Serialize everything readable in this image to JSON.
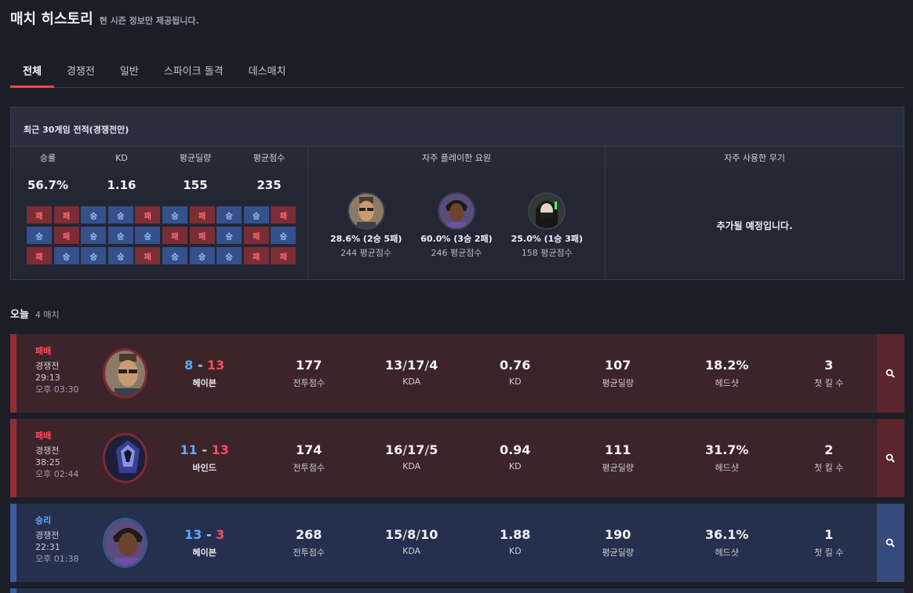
{
  "header": {
    "title": "매치 히스토리",
    "subtitle": "현 시즌 정보만 제공됩니다."
  },
  "tabs": [
    "전체",
    "경쟁전",
    "일반",
    "스파이크 돌격",
    "데스매치"
  ],
  "summary": {
    "title": "최근 30게임 전적(경쟁전만)",
    "stats": [
      {
        "label": "승률",
        "value": "56.7%"
      },
      {
        "label": "KD",
        "value": "1.16"
      },
      {
        "label": "평균딜량",
        "value": "155"
      },
      {
        "label": "평균점수",
        "value": "235"
      }
    ],
    "results": [
      "패",
      "패",
      "승",
      "승",
      "패",
      "승",
      "패",
      "승",
      "승",
      "패",
      "승",
      "패",
      "승",
      "승",
      "승",
      "패",
      "패",
      "승",
      "패",
      "승",
      "패",
      "승",
      "승",
      "승",
      "패",
      "승",
      "승",
      "승",
      "패",
      "패"
    ],
    "agents_title": "자주 플레이한 요원",
    "agents": [
      {
        "line1": "28.6% (2승 5패)",
        "line2": "244 평균점수",
        "skin": "#c99b72",
        "bg": "#8b7a66"
      },
      {
        "line1": "60.0% (3승 2패)",
        "line2": "246 평균점수",
        "skin": "#6b4330",
        "bg": "#5a4c7c"
      },
      {
        "line1": "25.0% (1승 3패)",
        "line2": "158 평균점수",
        "skin": "#e6d4c6",
        "bg": "#2f3a34"
      }
    ],
    "weapons_title": "자주 사용한 무기",
    "weapons_msg": "추가될 예정입니다."
  },
  "today": {
    "label": "오늘",
    "count": "4 매치"
  },
  "match_labels": {
    "combat": "전투점수",
    "kda": "KDA",
    "kd": "KD",
    "dmg": "평균딜량",
    "hs": "헤드샷",
    "fk": "첫 킬 수"
  },
  "matches": [
    {
      "result": "패배",
      "mode": "경쟁전",
      "duration": "29:13",
      "time": "오후 03:30",
      "score_a": "8",
      "score_b": "13",
      "map": "헤이븐",
      "combat": "177",
      "kills": "13",
      "deaths": "17",
      "assists": "4",
      "kd": "0.76",
      "dmg": "107",
      "hs": "18.2%",
      "fk": "3"
    },
    {
      "result": "패배",
      "mode": "경쟁전",
      "duration": "38:25",
      "time": "오후 02:44",
      "score_a": "11",
      "score_b": "13",
      "map": "바인드",
      "combat": "174",
      "kills": "16",
      "deaths": "17",
      "assists": "5",
      "kd": "0.94",
      "dmg": "111",
      "hs": "31.7%",
      "fk": "2"
    },
    {
      "result": "승리",
      "mode": "경쟁전",
      "duration": "22:31",
      "time": "오후 01:38",
      "score_a": "13",
      "score_b": "3",
      "map": "헤이븐",
      "combat": "268",
      "kills": "15",
      "deaths": "8",
      "assists": "10",
      "kd": "1.88",
      "dmg": "190",
      "hs": "36.1%",
      "fk": "1"
    }
  ],
  "colors": {
    "accent": "#e24b55",
    "loss": "#ff4c5c",
    "win": "#5fa9ff"
  }
}
